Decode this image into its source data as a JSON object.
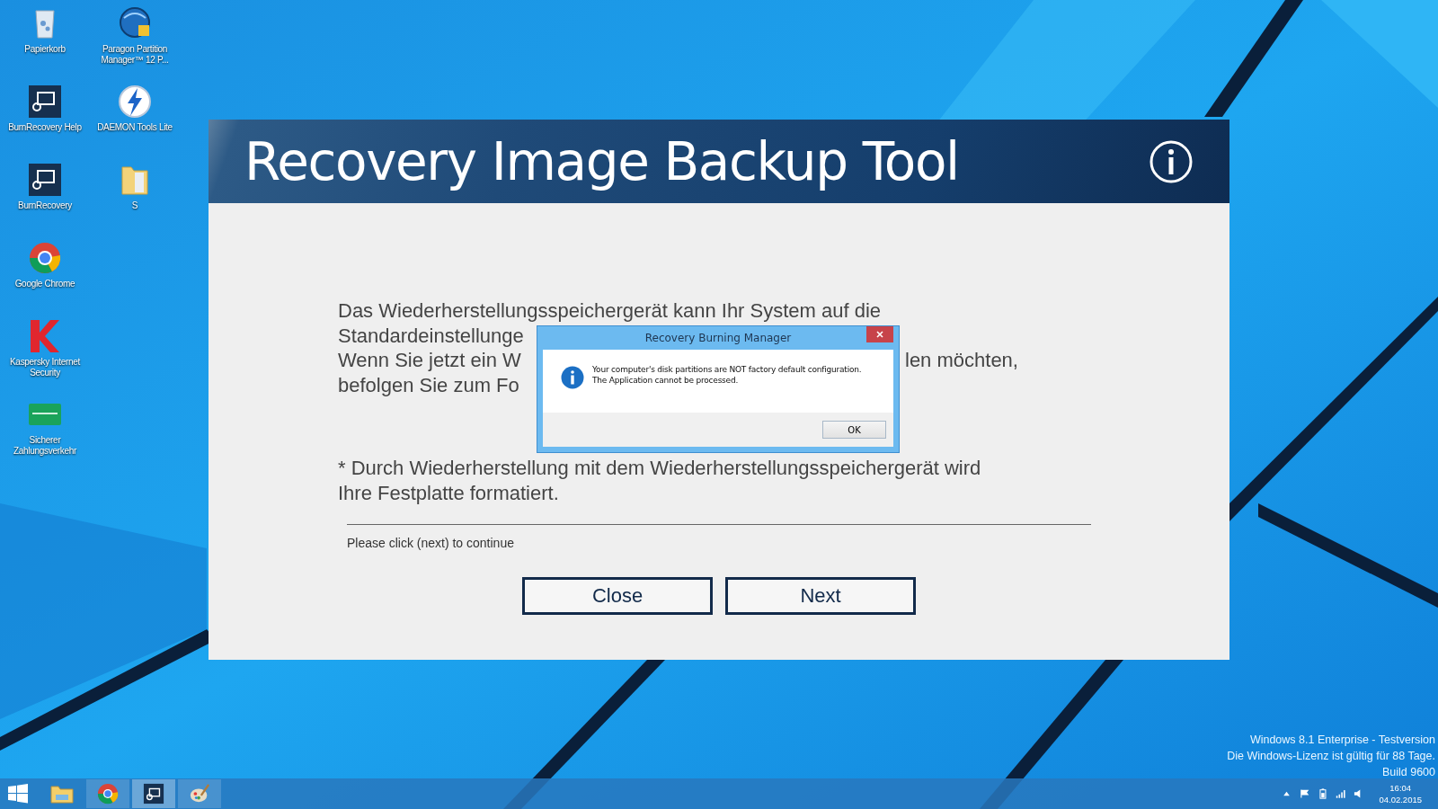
{
  "desktop_icons": [
    {
      "label": "Papierkorb",
      "kind": "bin"
    },
    {
      "label": "Paragon Partition Manager™ 12 P...",
      "kind": "disk"
    },
    {
      "label": "BurnRecovery Help",
      "kind": "monitor"
    },
    {
      "label": "DAEMON Tools Lite",
      "kind": "bolt"
    },
    {
      "label": "BurnRecovery",
      "kind": "monitor"
    },
    {
      "label": "S",
      "kind": "folder"
    },
    {
      "label": "Google Chrome",
      "kind": "chrome"
    },
    {
      "label": "Kaspersky Internet Security",
      "kind": "k"
    },
    {
      "label": "Sicherer Zahlungsverkehr",
      "kind": "card"
    }
  ],
  "app": {
    "title": "Recovery Image Backup Tool",
    "lines": [
      {
        "left": "Das Wiederherstellungsspeichergerät kann Ihr System auf die"
      },
      {
        "left": "Standardeinstellunge"
      },
      {
        "left": "Wenn Sie jetzt ein W",
        "right": "len möchten,"
      },
      {
        "left": "befolgen Sie zum Fo"
      }
    ],
    "note": [
      "* Durch Wiederherstellung mit dem Wiederherstellungsspeichergerät wird",
      "Ihre Festplatte formatiert."
    ],
    "hint": "Please click (next) to continue",
    "buttons": [
      "Close",
      "Next"
    ]
  },
  "dialog": {
    "title": "Recovery Burning Manager",
    "message": [
      "Your computer's disk partitions are NOT factory default configuration.",
      "The Application cannot be processed."
    ],
    "button": "OK"
  },
  "system_notice": [
    "Windows 8.1 Enterprise - Testversion",
    "Die Windows-Lizenz ist gültig für 88 Tage.",
    "Build 9600"
  ],
  "taskbar": {
    "apps": [
      {
        "kind": "explorer",
        "running": false,
        "selected": false
      },
      {
        "kind": "chrome",
        "running": true,
        "selected": false
      },
      {
        "kind": "monitor",
        "running": true,
        "selected": true
      },
      {
        "kind": "paint",
        "running": true,
        "selected": false
      }
    ],
    "clock": {
      "time": "16:04",
      "date": "04.02.2015"
    }
  }
}
